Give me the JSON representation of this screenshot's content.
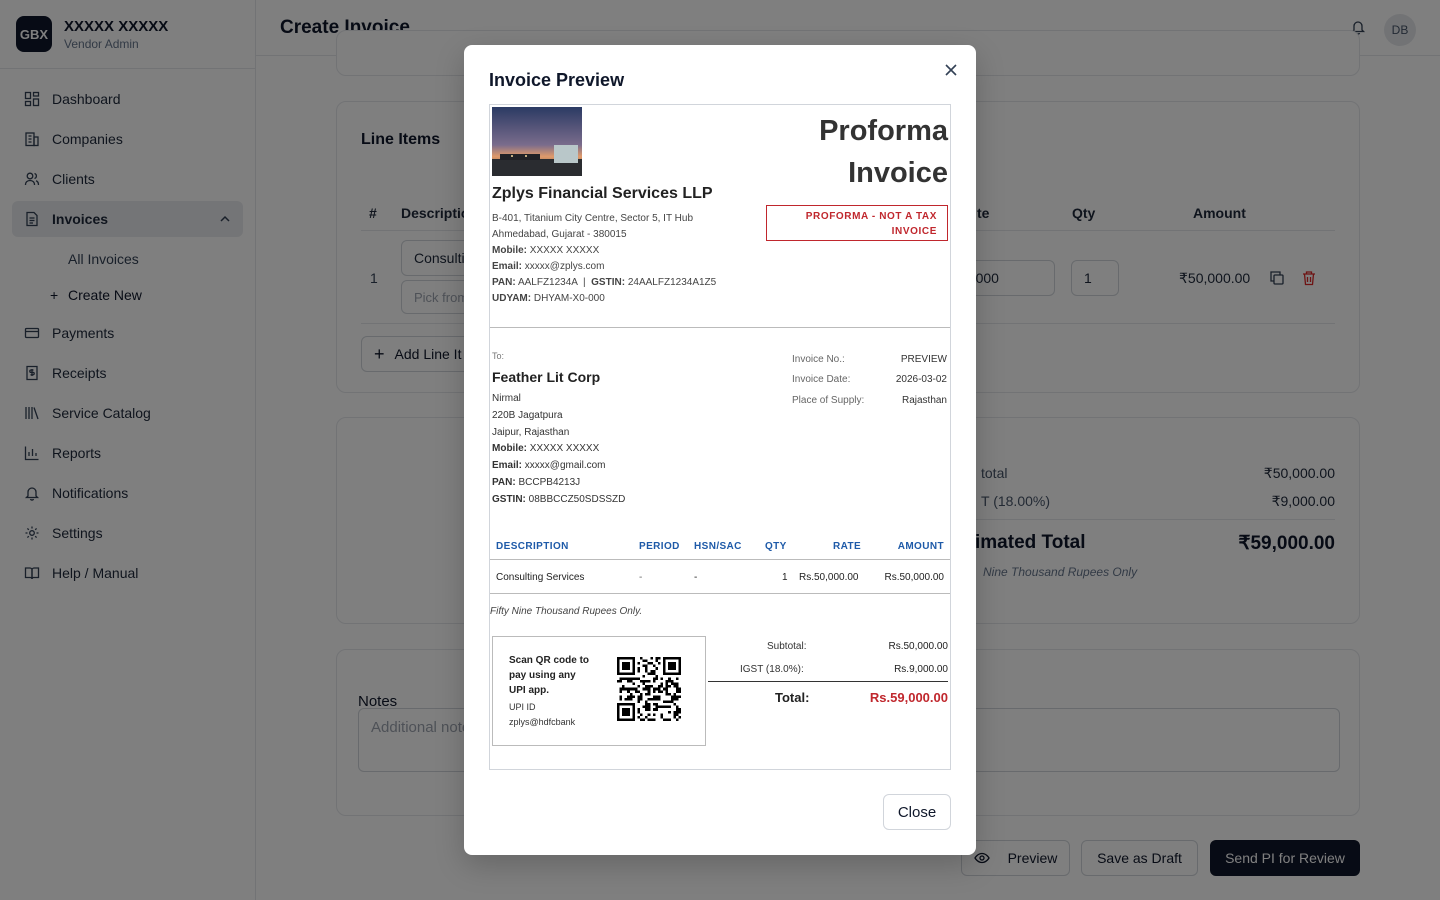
{
  "brand": {
    "logo": "GBX",
    "name": "XXXXX XXXXX",
    "role": "Vendor Admin"
  },
  "nav": {
    "dashboard": "Dashboard",
    "companies": "Companies",
    "clients": "Clients",
    "invoices": "Invoices",
    "all_invoices": "All Invoices",
    "create_new": "Create New",
    "payments": "Payments",
    "receipts": "Receipts",
    "service_catalog": "Service Catalog",
    "reports": "Reports",
    "notifications": "Notifications",
    "settings": "Settings",
    "help": "Help / Manual"
  },
  "header": {
    "title": "Create Invoice",
    "avatar": "DB"
  },
  "line_items": {
    "title": "Line Items",
    "col_num": "#",
    "col_desc": "Descriptio",
    "col_rate": "te",
    "col_qty": "Qty",
    "col_amount": "Amount",
    "row_num": "1",
    "desc_value": "Consulti",
    "period_placeholder": "Pick from",
    "rate_value": "50000",
    "qty_value": "1",
    "amount": "₹50,000.00",
    "add_label": "Add Line It"
  },
  "summary": {
    "subtotal_label": "total",
    "subtotal_value": "₹50,000.00",
    "tax_label": "T (18.00%)",
    "tax_value": "₹9,000.00",
    "total_label": "imated Total",
    "total_value": "₹59,000.00",
    "words": "Nine Thousand Rupees Only"
  },
  "notes": {
    "label": "Notes",
    "placeholder": "Additional note"
  },
  "actions": {
    "preview": "Preview",
    "draft": "Save as Draft",
    "send": "Send PI for Review"
  },
  "modal": {
    "title": "Invoice Preview",
    "close_label": "Close",
    "doc": {
      "title_line1": "Proforma",
      "title_line2": "Invoice",
      "stamp_line1": "PROFORMA - NOT A TAX",
      "stamp_line2": "INVOICE",
      "company": "Zplys Financial Services LLP",
      "addr1": "B-401, Titanium City Centre, Sector 5, IT Hub",
      "addr2": "Ahmedabad, Gujarat - 380015",
      "mobile_label": "Mobile:",
      "mobile": "XXXXX XXXXX",
      "email_label": "Email:",
      "email": "xxxxx@zplys.com",
      "pan_label": "PAN:",
      "pan": "AALFZ1234A",
      "sep": "|",
      "gstin_label": "GSTIN:",
      "gstin": "24AALFZ1234A1Z5",
      "udyam_label": "UDYAM:",
      "udyam": "DHYAM-X0-000",
      "to_label": "To:",
      "client": "Feather Lit Corp",
      "client_contact": "Nirmal",
      "client_addr1": "220B Jagatpura",
      "client_addr2": "Jaipur, Rajasthan",
      "client_mobile": "XXXXX XXXXX",
      "client_email": "xxxxx@gmail.com",
      "client_pan": "BCCPB4213J",
      "client_gstin": "08BBCCZ50SDSSZD",
      "inv_no_label": "Invoice No.:",
      "inv_no": "PREVIEW",
      "inv_date_label": "Invoice Date:",
      "inv_date": "2026-03-02",
      "pos_label": "Place of Supply:",
      "pos": "Rajasthan",
      "th_desc": "DESCRIPTION",
      "th_period": "PERIOD",
      "th_hsn": "HSN/SAC",
      "th_qty": "QTY",
      "th_rate": "RATE",
      "th_amount": "AMOUNT",
      "row_desc": "Consulting Services",
      "row_period": "-",
      "row_hsn": "-",
      "row_qty": "1",
      "row_rate": "Rs.50,000.00",
      "row_amount": "Rs.50,000.00",
      "words": "Fifty Nine Thousand Rupees Only.",
      "qr_line1": "Scan QR code to",
      "qr_line2": "pay using any",
      "qr_line3": "UPI app.",
      "upi_label": "UPI ID",
      "upi_id": "zplys@hdfcbank",
      "subtotal_label": "Subtotal:",
      "subtotal": "Rs.50,000.00",
      "igst_label": "IGST (18.0%):",
      "igst": "Rs.9,000.00",
      "total_label": "Total:",
      "total": "Rs.59,000.00"
    }
  },
  "colors": {
    "accent_dark": "#0f172a",
    "doc_blue": "#1e5aa8",
    "doc_red": "#c0272d",
    "delete_red": "#dc2626"
  }
}
